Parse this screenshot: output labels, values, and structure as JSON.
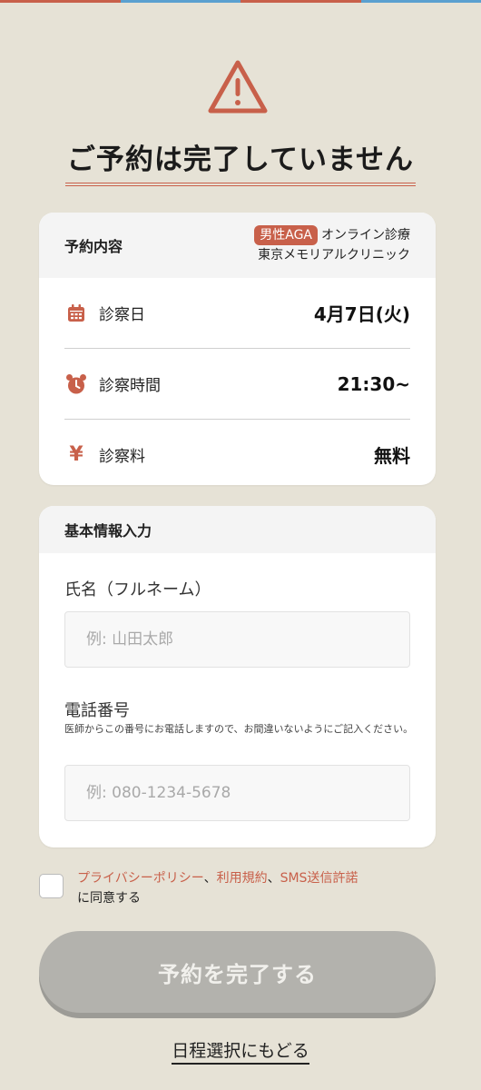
{
  "colors": {
    "accent": "#c8604a",
    "background": "#e6e2d6",
    "button_disabled": "#b3b2ad"
  },
  "header": {
    "icon": "warning-triangle-icon",
    "title": "ご予約は完了していません"
  },
  "reservation": {
    "heading": "予約内容",
    "badge": "男性AGA",
    "service": "オンライン診療",
    "clinic": "東京メモリアルクリニック",
    "rows": [
      {
        "icon": "calendar-icon",
        "label": "診察日",
        "value": "4月7日(火)"
      },
      {
        "icon": "alarm-clock-icon",
        "label": "診察時間",
        "value": "21:30~"
      },
      {
        "icon": "yen-icon",
        "glyph": "¥",
        "label": "診察料",
        "value": "無料"
      }
    ]
  },
  "basic_info": {
    "heading": "基本情報入力",
    "name": {
      "label": "氏名（フルネーム）",
      "placeholder": "例: 山田太郎",
      "value": ""
    },
    "phone": {
      "label": "電話番号",
      "note": "医師からこの番号にお電話しますので、お間違いないようにご記入ください。",
      "placeholder": "例: 080-1234-5678",
      "value": ""
    }
  },
  "consent": {
    "checked": false,
    "link_privacy": "プライバシーポリシー",
    "sep1": "、",
    "link_terms": "利用規約",
    "sep2": "、",
    "link_sms": "SMS送信許諾",
    "suffix": "に同意する"
  },
  "actions": {
    "submit_label": "予約を完了する",
    "back_label": "日程選択にもどる"
  }
}
